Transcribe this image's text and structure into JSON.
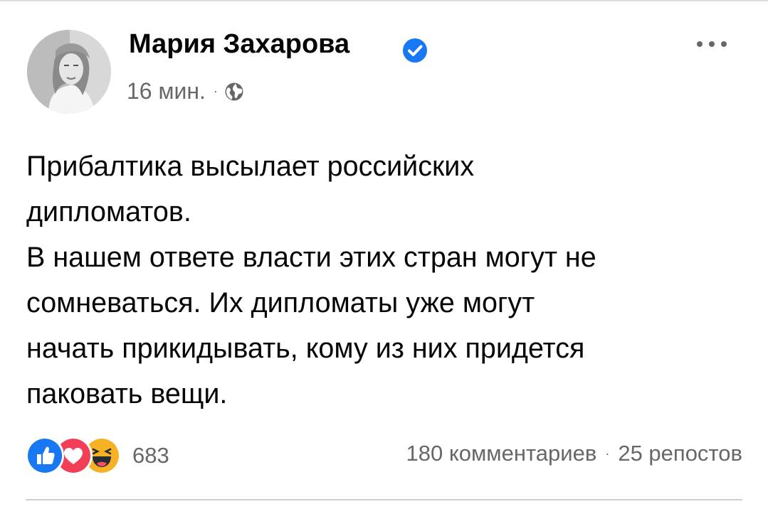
{
  "author": {
    "name": "Мария Захарова",
    "verified": true,
    "avatar": "profile-photo"
  },
  "meta": {
    "time": "16 мин.",
    "separator": "·",
    "privacy_icon": "globe-icon"
  },
  "post": {
    "lines": [
      "Прибалтика высылает российских",
      "дипломатов.",
      "В нашем ответе власти этих стран могут не",
      "сомневаться. Их дипломаты уже могут",
      "начать прикидывать, кому из них придется",
      "паковать вещи."
    ]
  },
  "reactions": {
    "icons": [
      "like-icon",
      "love-icon",
      "haha-icon"
    ],
    "count": "683"
  },
  "stats": {
    "comments": "180 комментариев",
    "separator": "·",
    "shares": "25 репостов"
  },
  "colors": {
    "text": "#050505",
    "secondary": "#65676b",
    "verified": "#1877f2",
    "like": "#1877f2",
    "love": "#f33e58",
    "haha": "#f7b125"
  },
  "more_icon": "more-options-icon"
}
